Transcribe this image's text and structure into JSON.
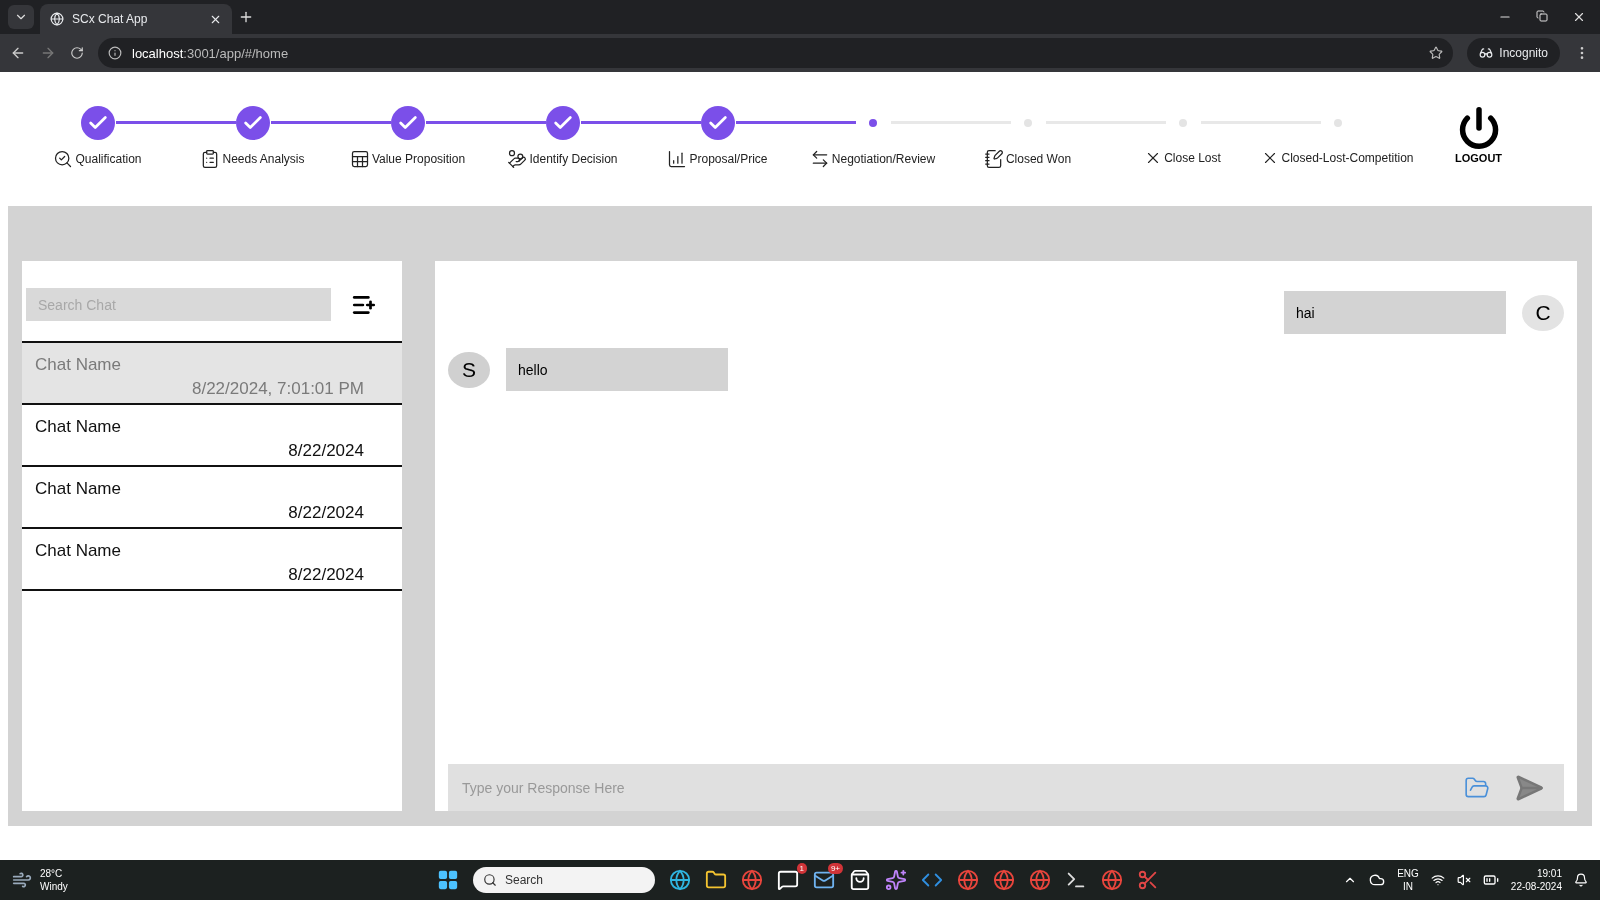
{
  "browser": {
    "tab_title": "SCx Chat App",
    "url_host": "localhost",
    "url_path": ":3001/app/#/home",
    "profile": "Incognito"
  },
  "steps": [
    {
      "label": "Qualification",
      "completed": true,
      "kind": "magnifier"
    },
    {
      "label": "Needs Analysis",
      "completed": true,
      "kind": "checklist"
    },
    {
      "label": "Value Proposition",
      "completed": true,
      "kind": "table"
    },
    {
      "label": "Identify Decision",
      "completed": true,
      "kind": "hand"
    },
    {
      "label": "Proposal/Price",
      "completed": true,
      "kind": "chart"
    },
    {
      "label": "Negotiation/Review",
      "completed": false,
      "kind": "swap"
    },
    {
      "label": "Closed Won",
      "completed": false,
      "kind": "notepad"
    },
    {
      "label": "Close Lost",
      "completed": false,
      "kind": "cross"
    },
    {
      "label": "Closed-Lost-Competition",
      "completed": false,
      "kind": "cross"
    }
  ],
  "logout": {
    "label": "LOGOUT"
  },
  "chat_list": {
    "search": {
      "placeholder": "Search Chat"
    },
    "items": [
      {
        "name": "Chat Name",
        "date": "8/22/2024, 7:01:01 PM",
        "selected": true
      },
      {
        "name": "Chat Name",
        "date": "8/22/2024",
        "selected": false
      },
      {
        "name": "Chat Name",
        "date": "8/22/2024",
        "selected": false
      },
      {
        "name": "Chat Name",
        "date": "8/22/2024",
        "selected": false
      }
    ]
  },
  "messages": [
    {
      "kind": "sent",
      "avatar": "C",
      "text": "hai"
    },
    {
      "kind": "received",
      "avatar": "S",
      "text": "hello"
    }
  ],
  "composer": {
    "placeholder": "Type your Response Here"
  },
  "taskbar": {
    "temperature": "28°C",
    "weather": "Windy",
    "search": "Search",
    "apps": [
      {
        "kind": "edge"
      },
      {
        "kind": "folder"
      },
      {
        "kind": "chrome"
      },
      {
        "kind": "chat",
        "badge": "1"
      },
      {
        "kind": "mail",
        "badge": "9+"
      },
      {
        "kind": "store"
      },
      {
        "kind": "copilot"
      },
      {
        "kind": "code"
      },
      {
        "kind": "chrome"
      },
      {
        "kind": "chrome"
      },
      {
        "kind": "chrome"
      },
      {
        "kind": "terminal"
      },
      {
        "kind": "chrome"
      },
      {
        "kind": "snip"
      }
    ],
    "language": "ENG",
    "region": "IN",
    "time": "19:01",
    "date": "22-08-2024"
  }
}
